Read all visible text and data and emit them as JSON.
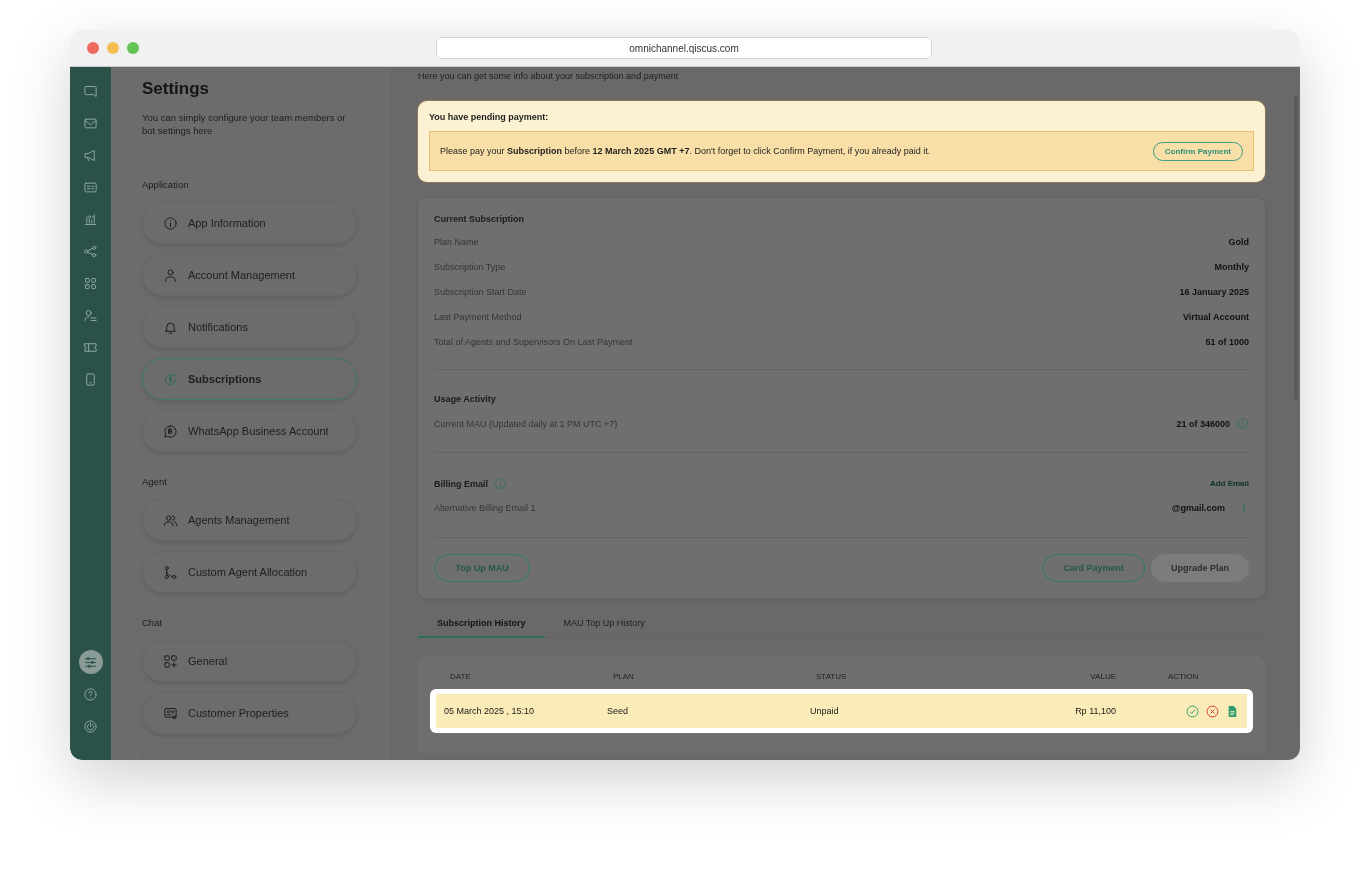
{
  "browser": {
    "url": "omnichannel.qiscus.com"
  },
  "nav_rail": {
    "items": [
      {
        "selected": false
      },
      {
        "selected": false
      },
      {
        "selected": false
      },
      {
        "selected": false
      },
      {
        "selected": false
      },
      {
        "selected": false
      },
      {
        "selected": false
      },
      {
        "selected": false
      },
      {
        "selected": false
      },
      {
        "selected": false
      }
    ],
    "bottom_items": [
      {
        "selected": true
      },
      {
        "selected": false
      },
      {
        "selected": false
      }
    ]
  },
  "settings": {
    "title": "Settings",
    "subtitle": "You can simply configure your team members or bot settings here",
    "sections": [
      {
        "label": "Application",
        "items": [
          {
            "label": "App Information",
            "selected": false
          },
          {
            "label": "Account Management",
            "selected": false
          },
          {
            "label": "Notifications",
            "selected": false
          },
          {
            "label": "Subscriptions",
            "selected": true
          },
          {
            "label": "WhatsApp Business Account",
            "selected": false
          }
        ]
      },
      {
        "label": "Agent",
        "items": [
          {
            "label": "Agents Management",
            "selected": false
          },
          {
            "label": "Custom Agent Allocation",
            "selected": false
          }
        ]
      },
      {
        "label": "Chat",
        "items": [
          {
            "label": "General",
            "selected": false
          },
          {
            "label": "Customer Properties",
            "selected": false
          }
        ]
      }
    ]
  },
  "main": {
    "description": "Here you can get some info about your subscription and payment",
    "banner": {
      "title": "You have pending payment:",
      "message": "Please pay your **Subscription** before **12 March 2025 GMT +7**. Don't forget to click Confirm Payment, if you already paid it.",
      "button": "Confirm Payment"
    },
    "current_subscription": {
      "title": "Current Subscription",
      "rows": [
        {
          "label": "Plan Name",
          "value": "Gold"
        },
        {
          "label": "Subscription Type",
          "value": "Monthly"
        },
        {
          "label": "Subscription Start Date",
          "value": "16 January 2025"
        },
        {
          "label": "Last Payment Method",
          "value": "Virtual Account"
        },
        {
          "label": "Total of Agents and Supervisors On Last Payment",
          "value": "51 of 1000"
        }
      ]
    },
    "usage_activity": {
      "title": "Usage Activity",
      "rows": [
        {
          "label": "Current MAU (Updated daily at 1 PM UTC +7)",
          "value": "21 of 346000"
        }
      ]
    },
    "billing_email": {
      "title": "Billing Email",
      "action": "Add Email",
      "rows": [
        {
          "label": "Alternative Billing Email 1",
          "value": "@gmail.com"
        }
      ]
    },
    "buttons": [
      {
        "label": "Top Up MAU",
        "kind": "outline"
      },
      {
        "label": "Card Payment",
        "kind": "outline"
      },
      {
        "label": "Upgrade Plan",
        "kind": "disabled"
      }
    ],
    "tabs": [
      {
        "label": "Subscription History",
        "selected": true
      },
      {
        "label": "MAU Top Up History",
        "selected": false
      }
    ],
    "table": {
      "columns": [
        "DATE",
        "PLAN",
        "STATUS",
        "VALUE",
        "ACTION"
      ],
      "rows": [
        {
          "date": "05 March 2025 , 15:10",
          "plan": "Seed",
          "status": "Unpaid",
          "value": "Rp 11,100",
          "highlighted": true
        }
      ]
    }
  }
}
